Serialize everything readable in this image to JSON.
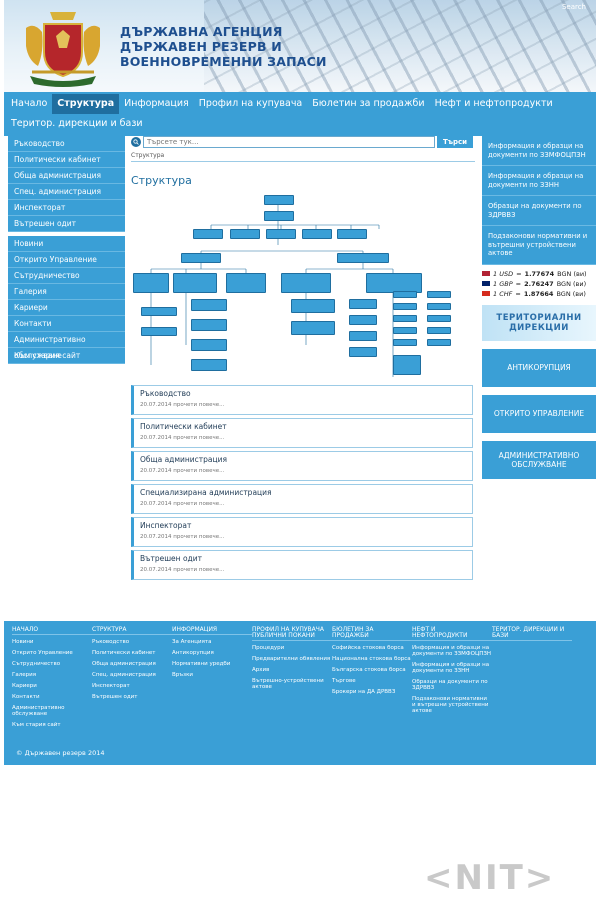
{
  "header": {
    "title_line1": "ДЪРЖАВНА АГЕНЦИЯ",
    "title_line2": "ДЪРЖАВЕН РЕЗЕРВ И",
    "title_line3": "ВОЕННОВРЕМЕННИ ЗАПАСИ",
    "top_link": "Search"
  },
  "nav": {
    "row1": [
      "Начало",
      "Структура",
      "Информация",
      "Профил на купувача",
      "Бюлетин за продажби",
      "Нефт и нефтопродукти"
    ],
    "row2": [
      "Територ. дирекции и бази"
    ],
    "active": "Структура"
  },
  "left_menu": {
    "group1": [
      "Ръководство",
      "Политически кабинет",
      "Обща администрация",
      "Спец. администрация",
      "Инспекторат",
      "Вътрешен одит"
    ],
    "group2": [
      "Новини",
      "Открито Управление",
      "Сътрудничество",
      "Галерия",
      "Кариери",
      "Контакти",
      "Административно обслужване",
      "Към стария сайт"
    ]
  },
  "search": {
    "placeholder": "Търсете тук...",
    "button": "Търси"
  },
  "breadcrumb": "Структура",
  "page_title": "Структура",
  "cards": [
    {
      "title": "Ръководство",
      "date": "20.07.2014",
      "more": "прочети повече..."
    },
    {
      "title": "Политически кабинет",
      "date": "20.07.2014",
      "more": "прочети повече..."
    },
    {
      "title": "Обща администрация",
      "date": "20.07.2014",
      "more": "прочети повече..."
    },
    {
      "title": "Специализирана администрация",
      "date": "20.07.2014",
      "more": "прочети повече..."
    },
    {
      "title": "Инспекторат",
      "date": "20.07.2014",
      "more": "прочети повече..."
    },
    {
      "title": "Вътрешен одит",
      "date": "20.07.2014",
      "more": "прочети повече..."
    }
  ],
  "right_links": [
    "Информация и образци на документи по ЗЗМФОЦПЗН",
    "Информация и образци на документи по ЗЗНН",
    "Образци на документи по ЗДРВВЗ",
    "Подзаконови нормативни и вътрешни устройствени актове"
  ],
  "exchange": [
    {
      "amount": "1 USD",
      "rate": "1.77674",
      "unit": "BGN (ви)",
      "flag_color": "#b22234"
    },
    {
      "amount": "1 GBP",
      "rate": "2.76247",
      "unit": "BGN (ви)",
      "flag_color": "#012169"
    },
    {
      "amount": "1 CHF",
      "rate": "1.87664",
      "unit": "BGN (ви)",
      "flag_color": "#d52b1e"
    }
  ],
  "banner": {
    "line1": "ТЕРИТОРИАЛНИ",
    "line2": "ДИРЕКЦИИ"
  },
  "big_buttons": [
    "АНТИКОРУПЦИЯ",
    "ОТКРИТО УПРАВЛЕНИЕ",
    "АДМИНИСТРАТИВНО ОБСЛУЖВАНЕ"
  ],
  "footer": {
    "columns": [
      {
        "head": "Начало",
        "items": [
          "Новини",
          "Открито Управление",
          "Сътрудничество",
          "Галерия",
          "Кариери",
          "Контакти",
          "Административно обслужване",
          "Към стария сайт"
        ]
      },
      {
        "head": "Структура",
        "items": [
          "Ръководство",
          "Политически кабинет",
          "Обща администрация",
          "Спец. администрация",
          "Инспекторат",
          "Вътрешен одит"
        ]
      },
      {
        "head": "Информация",
        "items": [
          "За Агенцията",
          "Антикорупция",
          "Нормативни уредби",
          "Връзки"
        ]
      },
      {
        "head": "Профил на купувача Публични покани",
        "items": [
          "Процедури",
          "Предварителни обявления",
          "Архив",
          "Вътрешно-устройствени актове"
        ]
      },
      {
        "head": "Бюлетин за продажби",
        "items": [
          "Софийска стокова борса",
          "Национална стокова борса",
          "Българска стокова борса",
          "Търгове",
          "Брокери на ДА ДРВВЗ"
        ]
      },
      {
        "head": "Нефт и нефтопродукти",
        "items": [
          "Информация и образци на документи по ЗЗМФОЦПЗН",
          "Информация и образци на документи по ЗЗНН",
          "Образци на документи по ЗДРВВЗ",
          "Подзаконови нормативни и вътрешни устройствени актове"
        ]
      },
      {
        "head": "Територ. дирекции и бази",
        "items": []
      }
    ],
    "copyright": "© Държавен резерв 2014"
  },
  "watermark": "<NIT>"
}
